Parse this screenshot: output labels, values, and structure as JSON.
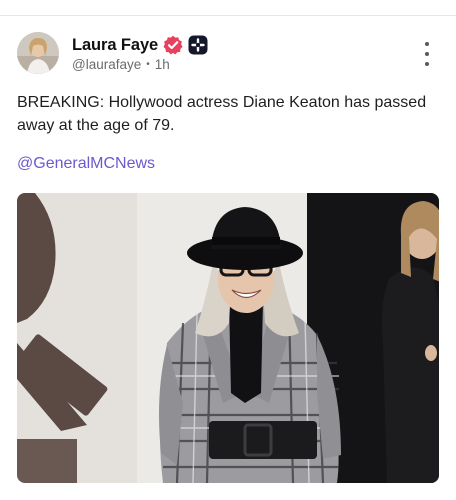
{
  "post": {
    "author": {
      "display_name": "Laura Faye",
      "handle": "@laurafaye",
      "time_ago": "1h",
      "separator": "•",
      "avatar_icon": "avatar-photo",
      "verified_icon": "verified-badge-icon",
      "verified_color": "#e9405d",
      "plus_icon": "plus-badge-icon"
    },
    "text": "BREAKING: Hollywood actress Diane Keaton has passed away at the age of 79.",
    "mention": "@GeneralMCNews",
    "mention_color": "#6a5acd",
    "menu_icon": "more-vertical-icon",
    "media": {
      "icon": "photo-image"
    }
  }
}
